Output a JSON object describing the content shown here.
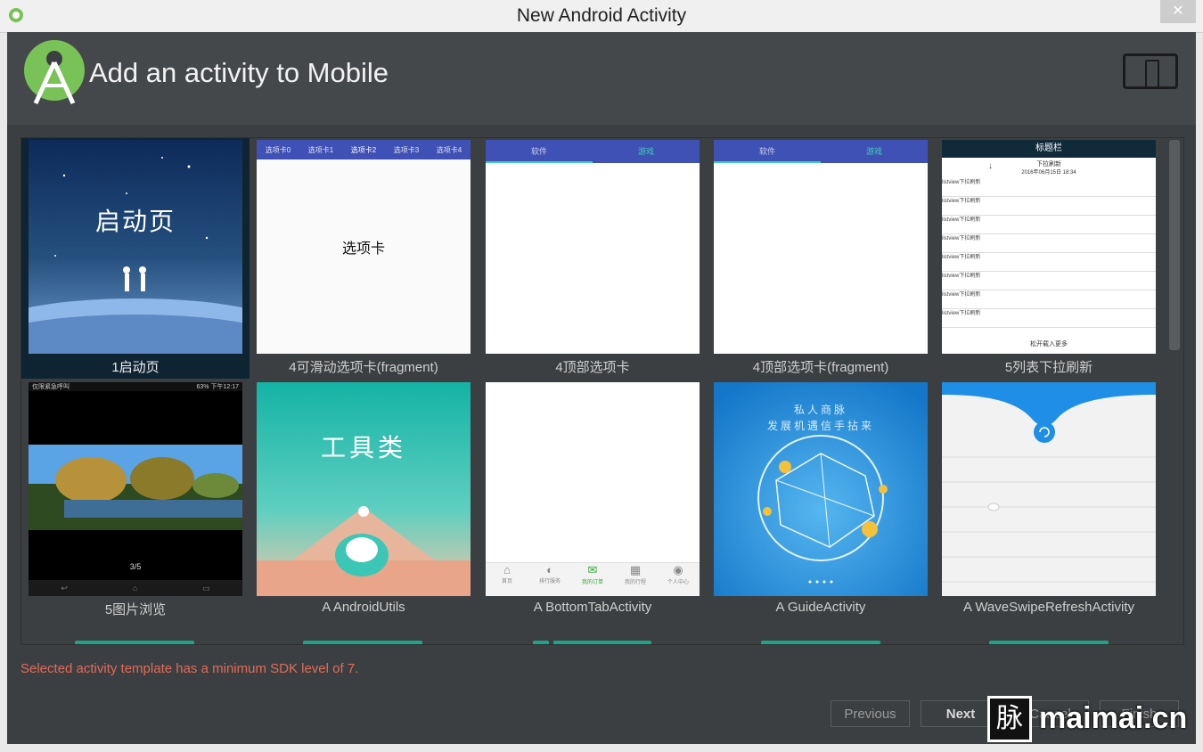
{
  "window": {
    "title": "New Android Activity",
    "close_glyph": "✕"
  },
  "header": {
    "title": "Add an activity to Mobile",
    "logo_icon": "android-studio-icon",
    "device_icon": "phone-tablet-icon"
  },
  "templates": [
    {
      "label": "1启动页",
      "selected": true,
      "thumb_text": "启动页"
    },
    {
      "label": "4可滑动选项卡(fragment)",
      "thumb_text": "选项卡",
      "tabs": [
        "选项卡0",
        "选项卡1",
        "选项卡2",
        "选项卡3",
        "选项卡4"
      ]
    },
    {
      "label": "4顶部选项卡",
      "tabs": [
        "软件",
        "游戏"
      ]
    },
    {
      "label": "4顶部选项卡(fragment)",
      "tabs": [
        "软件",
        "游戏"
      ]
    },
    {
      "label": "5列表下拉刷新",
      "bar_title": "标题栏",
      "refresh_text": "下拉刷新",
      "refresh_time": "2016年06月15日 18:34",
      "row_text": "listview下拉刷新",
      "footer": "松开载入更多"
    },
    {
      "label": "5图片浏览",
      "status_left": "仅限紧急呼叫",
      "status_right": "63% 下午12:17",
      "pager": "3/5"
    },
    {
      "label": "A AndroidUtils",
      "thumb_text": "工具类"
    },
    {
      "label": "A BottomTabActivity",
      "bottom_tabs": [
        "首页",
        "排行服务",
        "我的订单",
        "我的行程",
        "个人中心"
      ]
    },
    {
      "label": "A GuideActivity",
      "line1": "私人商脉",
      "line2": "发展机遇信手拈来"
    },
    {
      "label": "A WaveSwipeRefreshActivity"
    }
  ],
  "status": {
    "error": "Selected activity template has a minimum SDK level of 7."
  },
  "buttons": {
    "previous": "Previous",
    "next": "Next",
    "cancel": "Cancel",
    "finish": "Finish"
  },
  "watermark": {
    "glyph": "脉",
    "text": "maimai.cn"
  },
  "colors": {
    "accent_green": "#1fa489",
    "error_red": "#e06b5a",
    "tab_blue": "#3f51b5",
    "android_green": "#78c257"
  }
}
